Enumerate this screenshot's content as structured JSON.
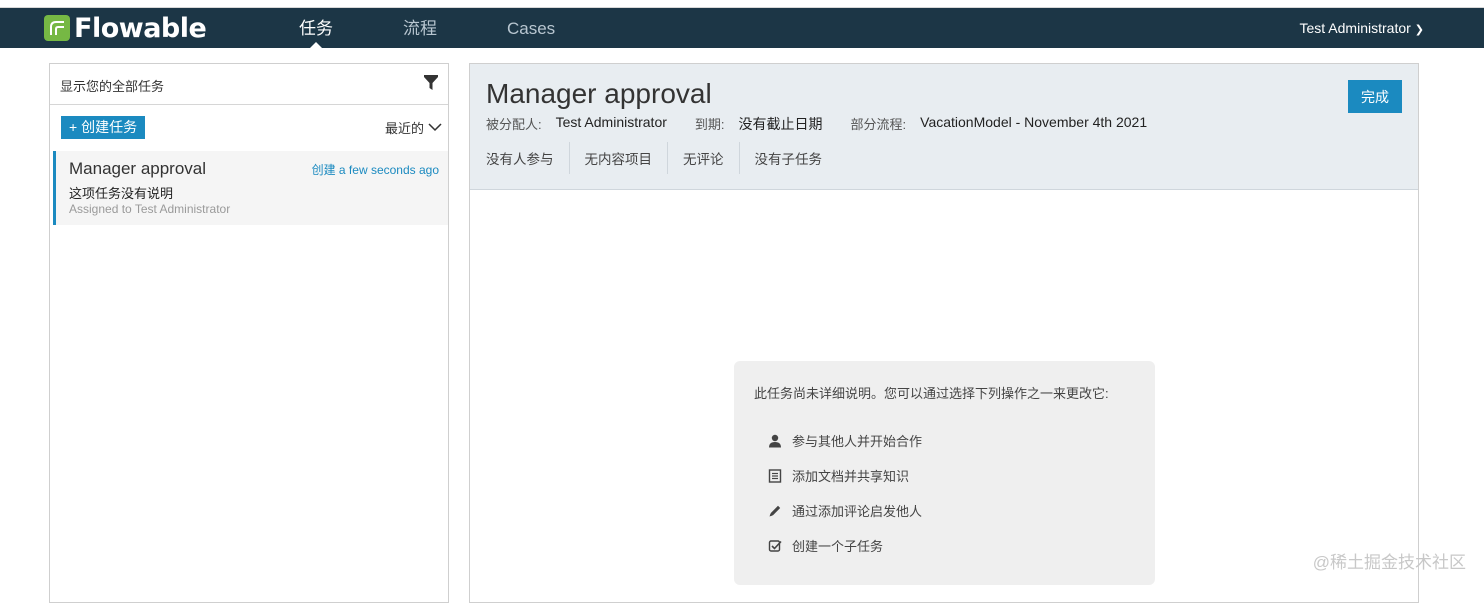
{
  "nav": {
    "logo": "Flowable",
    "tabs": [
      {
        "label": "任务"
      },
      {
        "label": "流程"
      },
      {
        "label": "Cases"
      }
    ],
    "user": "Test Administrator"
  },
  "left": {
    "filter_text": "显示您的全部任务",
    "create_label": "+ 创建任务",
    "sort_label": "最近的",
    "task": {
      "title": "Manager approval",
      "created": "创建 a few seconds ago",
      "description": "这项任务没有说明",
      "assigned": "Assigned to Test Administrator"
    }
  },
  "detail": {
    "title": "Manager approval",
    "complete_label": "完成",
    "assignee_label": "被分配人:",
    "assignee_value": "Test Administrator",
    "due_label": "到期:",
    "due_value": "没有截止日期",
    "process_label": "部分流程:",
    "process_value": "VacationModel - November 4th 2021",
    "sub_tabs": [
      {
        "label": "没有人参与"
      },
      {
        "label": "无内容项目"
      },
      {
        "label": "无评论"
      },
      {
        "label": "没有子任务"
      }
    ],
    "empty_text": "此任务尚未详细说明。您可以通过选择下列操作之一来更改它:",
    "actions": [
      {
        "label": "参与其他人并开始合作",
        "icon": "user-icon"
      },
      {
        "label": "添加文档并共享知识",
        "icon": "document-icon"
      },
      {
        "label": "通过添加评论启发他人",
        "icon": "pencil-icon"
      },
      {
        "label": "创建一个子任务",
        "icon": "checkbox-icon"
      }
    ]
  },
  "watermark": "@稀土掘金技术社区",
  "colors": {
    "navbar": "#1c3646",
    "accent": "#1b8ac0",
    "logo_green": "#76b844",
    "header_bg": "#e8edf1"
  }
}
